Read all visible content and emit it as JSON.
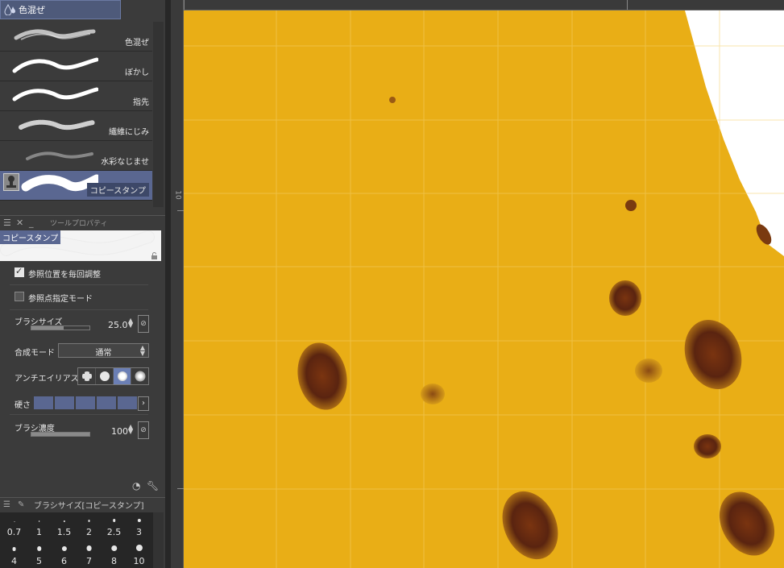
{
  "subtool": {
    "header_label": "色混ぜ",
    "brushes": [
      {
        "label": "色混ぜ"
      },
      {
        "label": "ぼかし"
      },
      {
        "label": "指先"
      },
      {
        "label": "繊維にじみ"
      },
      {
        "label": "水彩なじませ"
      },
      {
        "label": "コピースタンプ",
        "selected": true
      }
    ]
  },
  "tool_property": {
    "panel_title": "ツールプロパティ",
    "preview_label": "コピースタンプ",
    "options": [
      {
        "label": "参照位置を毎回調整",
        "checked": true
      },
      {
        "label": "参照点指定モード",
        "checked": false
      }
    ],
    "brush_size": {
      "label": "ブラシサイズ",
      "value": "25.0",
      "fill": 0.55
    },
    "blend_mode": {
      "label": "合成モード",
      "value": "通常"
    },
    "antialias": {
      "label": "アンチエイリアス",
      "selected_index": 2
    },
    "hardness": {
      "label": "硬さ",
      "segments": 5
    },
    "brush_density": {
      "label": "ブラシ濃度",
      "value": "100",
      "fill": 1.0
    }
  },
  "brush_size_palette": {
    "title": "ブラシサイズ[コピースタンプ]",
    "row1": [
      "0.7",
      "1",
      "1.5",
      "2",
      "2.5",
      "3"
    ],
    "row2": [
      "4",
      "5",
      "6",
      "7",
      "8",
      "10"
    ]
  },
  "ruler": {
    "vertical_label": "10"
  },
  "colors": {
    "panel_bg": "#3b3b3b",
    "selection": "#5a6791",
    "canvas_yellow": "#e9ae16",
    "spot": "#5a2a12"
  },
  "icons": [
    "water-drop-icon",
    "stamp-icon",
    "lock-icon",
    "checkbox-icon",
    "spin-icon",
    "pressure-icon",
    "menu-icon",
    "close-icon",
    "minimize-icon",
    "brush-icon",
    "chevron-right-icon",
    "settings-icon",
    "wrench-icon"
  ]
}
